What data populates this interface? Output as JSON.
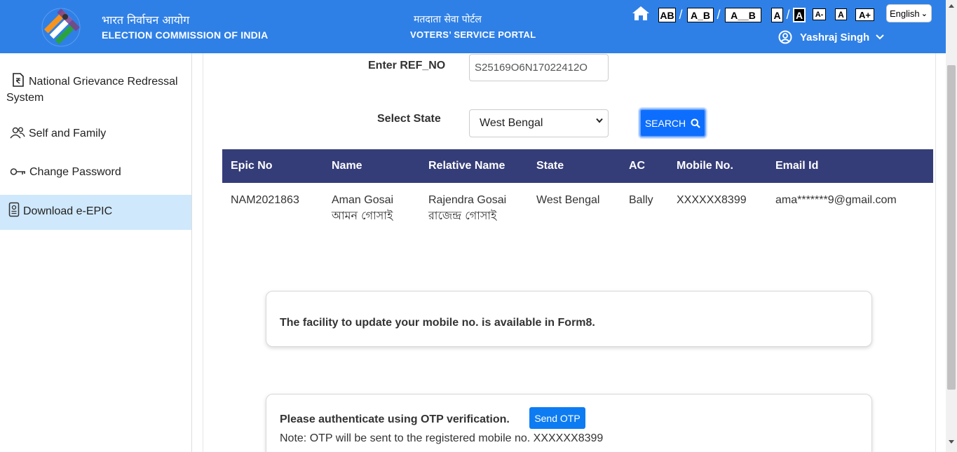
{
  "header": {
    "org_hindi": "भारत निर्वाचन आयोग",
    "org_english": "ELECTION COMMISSION OF INDIA",
    "portal_hindi": "मतदाता सेवा पोर्टल",
    "portal_english": "VOTERS’ SERVICE PORTAL",
    "accessibility": [
      "AB",
      "/",
      "A_B",
      "/",
      "A__B",
      "A",
      "/",
      "A",
      "A-",
      "A",
      "A+"
    ],
    "language": "English",
    "user_name": "Yashraj Singh",
    "colors": {
      "bar": "#2f80e6"
    }
  },
  "sidebar": {
    "items": [
      {
        "label": "National Grievance Redressal System",
        "icon": "document-rupee-icon"
      },
      {
        "label": "Self and Family",
        "icon": "people-icon"
      },
      {
        "label": "Change Password",
        "icon": "key-icon"
      },
      {
        "label": "Download e-EPIC",
        "icon": "id-card-icon",
        "active": true
      }
    ]
  },
  "form": {
    "ref_label": "Enter REF_NO",
    "ref_value": "S25169O6N17022412O",
    "state_label": "Select State",
    "state_value": "West Bengal",
    "search_label": "SEARCH"
  },
  "table": {
    "headers": [
      "Epic No",
      "Name",
      "Relative Name",
      "State",
      "AC",
      "Mobile No.",
      "Email Id"
    ],
    "rows": [
      {
        "epic": "NAM2021863",
        "name": "Aman Gosai",
        "name_bn": "আমন গোসাই",
        "relative": "Rajendra Gosai",
        "relative_bn": "রাজেন্দ্র গোসাই",
        "state": "West Bengal",
        "ac": "Bally",
        "mobile": "XXXXXX8399",
        "email": "ama*******9@gmail.com"
      }
    ]
  },
  "notice": {
    "mobile_update": "The facility to update your mobile no. is available in Form8.",
    "otp_prompt": "Please authenticate using OTP verification.",
    "send_otp": "Send OTP",
    "otp_note": "Note: OTP will be sent to the registered mobile no. XXXXXX8399"
  }
}
